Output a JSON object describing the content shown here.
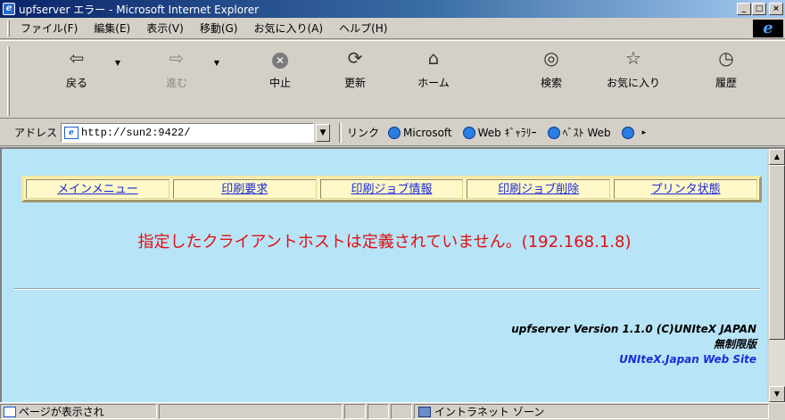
{
  "window": {
    "title": "upfserver エラー - Microsoft Internet Explorer",
    "controls": [
      "_",
      "□",
      "×"
    ]
  },
  "menubar": {
    "items": [
      "ファイル(F)",
      "編集(E)",
      "表示(V)",
      "移動(G)",
      "お気に入り(A)",
      "ヘルプ(H)"
    ]
  },
  "toolbar": {
    "back": {
      "label": "戻る",
      "icon": "back-arrow-icon"
    },
    "forward": {
      "label": "進む",
      "icon": "forward-arrow-icon"
    },
    "stop": {
      "label": "中止",
      "icon": "stop-icon"
    },
    "refresh": {
      "label": "更新",
      "icon": "refresh-icon"
    },
    "home": {
      "label": "ホーム",
      "icon": "home-icon"
    },
    "search": {
      "label": "検索",
      "icon": "search-icon"
    },
    "favorites": {
      "label": "お気に入り",
      "icon": "favorites-icon"
    },
    "history": {
      "label": "履歴",
      "icon": "history-icon"
    }
  },
  "addressbar": {
    "label": "アドレス",
    "url": "http://sun2:9422/",
    "links_label": "リンク",
    "links": [
      "Microsoft",
      "Web ｷﾞｬﾗﾘｰ",
      "ﾍﾞｽﾄ Web"
    ]
  },
  "page": {
    "nav": [
      "メインメニュー",
      "印刷要求",
      "印刷ジョブ情報",
      "印刷ジョブ削除",
      "プリンタ状態"
    ],
    "error_message": "指定したクライアントホストは定義されていません。(192.168.1.8)",
    "footer": {
      "version": "upfserver Version 1.1.0 (C)UNIteX JAPAN",
      "edition": "無制限版",
      "site_link": "UNIteX.Japan Web Site"
    },
    "colors": {
      "background": "#b8e4f8",
      "error": "#e01010",
      "link": "#1c2cd6",
      "nav_background": "#fff8c8"
    }
  },
  "statusbar": {
    "text": "ページが表示され",
    "zone": "イントラネット ゾーン"
  }
}
